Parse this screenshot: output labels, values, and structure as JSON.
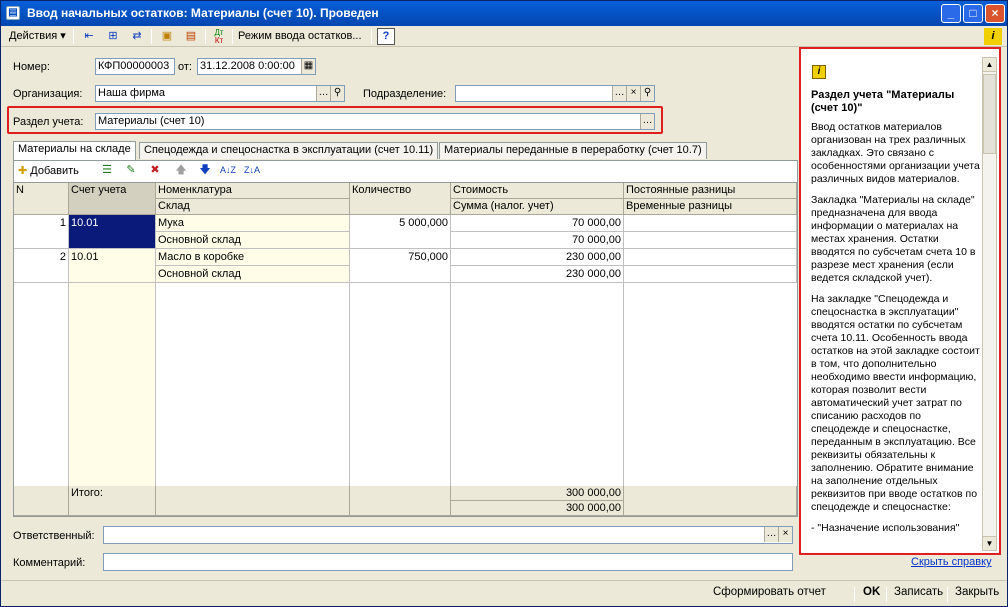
{
  "window": {
    "title": "Ввод начальных остатков: Материалы (счет 10). Проведен"
  },
  "toolbar": {
    "actions_label": "Действия",
    "mode_label": "Режим ввода остатков...",
    "help_label": "?"
  },
  "form": {
    "number_label": "Номер:",
    "number_value": "КФП00000003",
    "date_label": "от:",
    "date_value": "31.12.2008  0:00:00",
    "org_label": "Организация:",
    "org_value": "Наша фирма",
    "division_label": "Подразделение:",
    "division_value": "",
    "section_label": "Раздел учета:",
    "section_value": "Материалы (счет 10)"
  },
  "tabs": [
    {
      "label": "Материалы на складе"
    },
    {
      "label": "Спецодежда и спецоснастка в эксплуатации (счет 10.11)"
    },
    {
      "label": "Материалы переданные в переработку (счет 10.7)"
    }
  ],
  "grid_toolbar": {
    "add_label": "Добавить"
  },
  "grid": {
    "headers": {
      "n": "N",
      "account": "Счет учета",
      "nomenclature": "Номенклатура",
      "warehouse": "Склад",
      "quantity": "Количество",
      "cost": "Стоимость",
      "tax_sum": "Сумма (налог. учет)",
      "perm_diff": "Постоянные разницы",
      "temp_diff": "Временные разницы"
    },
    "rows": [
      {
        "n": "1",
        "account": "10.01",
        "nomenclature": "Мука",
        "warehouse": "Основной склад",
        "quantity": "5 000,000",
        "cost": "70 000,00",
        "tax_sum": "70 000,00"
      },
      {
        "n": "2",
        "account": "10.01",
        "nomenclature": "Масло в коробке",
        "warehouse": "Основной склад",
        "quantity": "750,000",
        "cost": "230 000,00",
        "tax_sum": "230 000,00"
      }
    ],
    "footer": {
      "label": "Итого:",
      "cost_total": "300 000,00",
      "tax_total": "300 000,00"
    }
  },
  "bottom": {
    "responsible_label": "Ответственный:",
    "responsible_value": "",
    "comment_label": "Комментарий:",
    "comment_value": "",
    "hide_help_link": "Скрыть справку"
  },
  "help": {
    "title": "Раздел учета \"Материалы (счет 10)\"",
    "p1": "Ввод остатков материалов организован на трех различных закладках. Это связано с особенностями организации учета различных видов материалов.",
    "p2": "Закладка \"Материалы на складе\" предназначена для ввода информации о материалах на местах хранения. Остатки вводятся по субсчетам счета 10 в разрезе мест хранения (если ведется складской учет).",
    "p3": "На закладке \"Спецодежда и спецоснастка в эксплуатации\" вводятся остатки по субсчетам счета 10.11. Особенность ввода остатков на этой закладке состоит в том, что дополнительно необходимо ввести информацию, которая позволит вести автоматический учет затрат по списанию расходов по спецодежде и спецоснастке, переданным в эксплуатацию. Все реквизиты обязательны к заполнению. Обратите внимание на заполнение отдельных реквизитов при вводе остатков по спецодежде и спецоснастке:",
    "p4": "- \"Назначение использования\""
  },
  "statusbar": {
    "report_label": "Сформировать отчет",
    "ok_label": "OK",
    "save_label": "Записать",
    "close_label": "Закрыть"
  },
  "colors": {
    "title_bg": "#0450c0",
    "highlight_red": "#e02020",
    "selected_cell": "#0a1a7a",
    "account_col_bg": "#fffde8"
  }
}
